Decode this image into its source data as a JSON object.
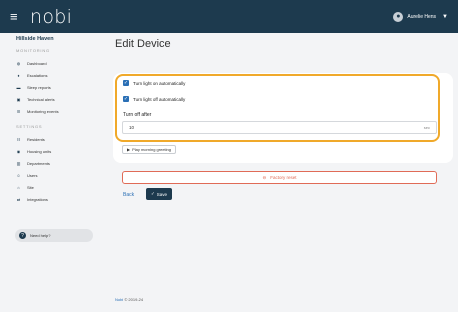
{
  "header": {
    "menu_icon": "hamburger-icon",
    "logo": "nobi",
    "user_name": "Aurelie Hens",
    "avatar_icon": "user-icon",
    "dropdown_icon": "chevron-down-icon"
  },
  "sidebar": {
    "site_name": "Hillside Haven",
    "monitoring_title": "MONITORING",
    "monitoring_items": [
      {
        "label": "Dashboard",
        "icon": "dashboard-icon"
      },
      {
        "label": "Escalations",
        "icon": "escalation-icon"
      },
      {
        "label": "Sleep reports",
        "icon": "bed-icon"
      },
      {
        "label": "Technical alerts",
        "icon": "alert-icon"
      },
      {
        "label": "Monitoring events",
        "icon": "list-icon"
      }
    ],
    "settings_title": "SETTINGS",
    "settings_items": [
      {
        "label": "Residents",
        "icon": "residents-icon"
      },
      {
        "label": "Housing units",
        "icon": "housing-icon"
      },
      {
        "label": "Departments",
        "icon": "building-icon"
      },
      {
        "label": "Users",
        "icon": "users-icon"
      },
      {
        "label": "Site",
        "icon": "home-icon"
      },
      {
        "label": "Integrations",
        "icon": "integrations-icon"
      }
    ],
    "help_label": "Need help?"
  },
  "main": {
    "title": "Edit Device",
    "checkbox_on": "Turn light on automatically",
    "checkbox_off": "Turn light off automatically",
    "turn_off_label": "Turn off after",
    "turn_off_value": "10",
    "turn_off_unit": "sec",
    "greeting_button": "Play morning greeting",
    "factory_reset": "Factory reset",
    "back": "Back",
    "save": "Save"
  },
  "footer": {
    "brand": "Nobi",
    "copyright": "© 2019-24"
  },
  "colors": {
    "topbar": "#1d3a4e",
    "highlight": "#f0a92a",
    "checkbox": "#2a6fb5",
    "danger": "#e06b57"
  }
}
